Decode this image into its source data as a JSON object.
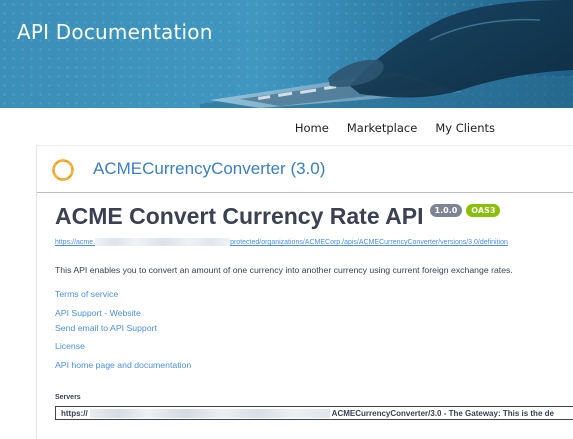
{
  "banner": {
    "title": "API Documentation",
    "colors": {
      "background": "#3f97c0",
      "title": "#ffffff"
    }
  },
  "nav": {
    "items": [
      {
        "label": "Home"
      },
      {
        "label": "Marketplace"
      },
      {
        "label": "My Clients"
      }
    ]
  },
  "api": {
    "logo_icon": "ring-logo-icon",
    "name": "ACMECurrencyConverter (3.0)",
    "title": "ACME Convert Currency Rate API",
    "version_badge": "1.0.0",
    "spec_badge": "OAS3",
    "definition_url_start": "https://acme.",
    "definition_url_end": "protected/organizations/ACMECorp./apis/ACMECurrencyConverter/versions/3.0/definition",
    "description": "This API enables you to convert an amount of one currency into another currency using current foreign exchange rates.",
    "links": {
      "terms": "Terms of service",
      "support_website": "API Support - Website",
      "support_email": "Send email to API Support",
      "license": "License",
      "home_page": "API home page and documentation"
    },
    "colors": {
      "accent": "#3b7fc4",
      "link": "#4990e2",
      "version_badge": "#7d8492",
      "spec_badge": "#89bf04",
      "logo": "#f0a020"
    }
  },
  "servers": {
    "label": "Servers",
    "selected_start": "https://",
    "selected_end": "ACMECurrencyConverter/3.0 - The Gateway: This is the de"
  }
}
